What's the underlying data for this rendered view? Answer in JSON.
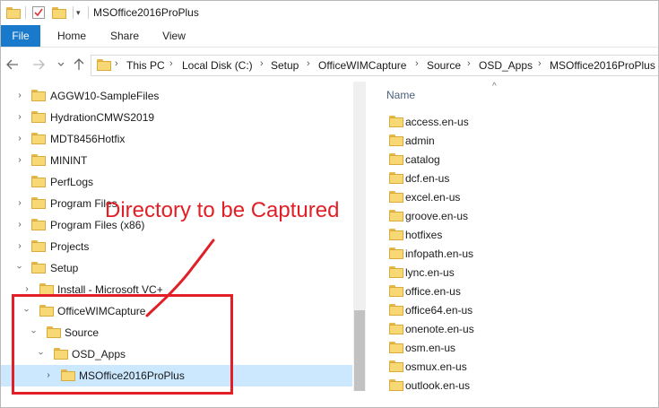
{
  "window": {
    "title": "MSOffice2016ProPlus"
  },
  "ribbon": {
    "tabs": [
      "File",
      "Home",
      "Share",
      "View"
    ]
  },
  "address": {
    "crumbs": [
      "This PC",
      "Local Disk (C:)",
      "Setup",
      "OfficeWIMCapture",
      "Source",
      "OSD_Apps",
      "MSOffice2016ProPlus"
    ]
  },
  "tree": {
    "items": [
      {
        "label": "AGGW10-SampleFiles"
      },
      {
        "label": "HydrationCMWS2019"
      },
      {
        "label": "MDT8456Hotfix"
      },
      {
        "label": "MININT"
      },
      {
        "label": "PerfLogs"
      },
      {
        "label": "Program Files"
      },
      {
        "label": "Program Files (x86)"
      },
      {
        "label": "Projects"
      },
      {
        "label": "Setup"
      },
      {
        "label": "Install - Microsoft VC+"
      },
      {
        "label": "OfficeWIMCapture"
      },
      {
        "label": "Source"
      },
      {
        "label": "OSD_Apps"
      },
      {
        "label": "MSOffice2016ProPlus"
      }
    ]
  },
  "list": {
    "column_header": "Name",
    "files": [
      "access.en-us",
      "admin",
      "catalog",
      "dcf.en-us",
      "excel.en-us",
      "groove.en-us",
      "hotfixes",
      "infopath.en-us",
      "lync.en-us",
      "office.en-us",
      "office64.en-us",
      "onenote.en-us",
      "osm.en-us",
      "osmux.en-us",
      "outlook.en-us"
    ]
  },
  "annotation": {
    "text": "Directory to be Captured",
    "color": "#e21f26"
  },
  "colors": {
    "accent": "#1979ca",
    "selection": "#cce8ff",
    "folder": "#f8d775"
  }
}
